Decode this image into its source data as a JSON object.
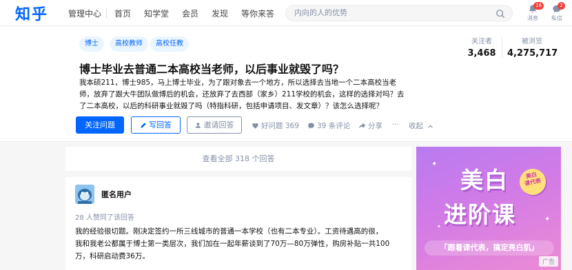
{
  "nav": {
    "logo": "知乎",
    "manage": "管理中心",
    "links": [
      "首页",
      "知学堂",
      "会员",
      "发现",
      "等你来答"
    ],
    "search_placeholder": "内向的人的优势",
    "messages_label": "消息",
    "messages_count": "18",
    "chat_label": "私信",
    "chat_count": "2"
  },
  "question": {
    "tags": [
      "博士",
      "高校教师",
      "高校任教"
    ],
    "title": "博士毕业去普通二本高校当老师，以后事业就毁了吗？",
    "description_lines": [
      "我本硕211，博士985，马上博士毕业，为了跟对象去一个地方，所以选择去当地一个二本高校当老",
      "师，放弃了跟大牛团队做博后的机会，还放弃了去西部（家乡）211学校的机会，这样的选择对吗？去",
      "了二本高校，以后的科研事业就毁了吗（特指科研，包括申请项目、发文章）？该怎么选择呢？"
    ],
    "followers_label": "关注者",
    "followers_value": "3,468",
    "views_label": "被浏览",
    "views_value": "4,275,717",
    "follow_button": "关注问题",
    "write_button": "写回答",
    "invite_button": "邀请回答",
    "good_question": "好问题 369",
    "comments": "39 条评论",
    "share": "分享",
    "more": "···",
    "collapse": "收起"
  },
  "answers": {
    "view_all": "查看全部 318 个回答",
    "first": {
      "author": "匿名用户",
      "upvote_note": "28 人赞同了该回答",
      "text_lines": [
        "我的经验很切题。刚决定签约一所三线城市的普通一本学校（也有二本专业）。工资待遇高的很，",
        "我和我老公都属于博士第一类层次，我们加在一起年薪谈到了70万—80万弹性，购房补贴一共100",
        "万，科研启动费36万。"
      ]
    }
  },
  "ad": {
    "line1": "美白",
    "line2": "进阶课",
    "seal_line1": "美白",
    "seal_line2": "课代表",
    "slogan": "「跟着课代表，搞定亮白肌」",
    "label": "广告"
  },
  "colors": {
    "brand": "#0066ff",
    "muted": "#8590a6",
    "badge": "#f1403c"
  }
}
